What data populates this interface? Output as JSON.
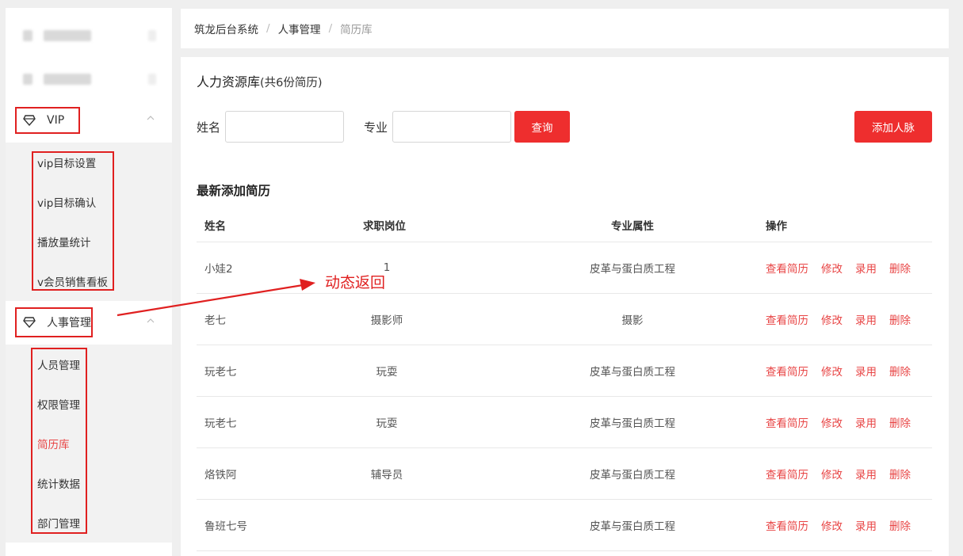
{
  "sidebar": {
    "vip_label": "VIP",
    "vip_items": [
      {
        "label": "vip目标设置"
      },
      {
        "label": "vip目标确认"
      },
      {
        "label": "播放量统计"
      },
      {
        "label": "v会员销售看板"
      }
    ],
    "hr_label": "人事管理",
    "hr_items": [
      {
        "label": "人员管理"
      },
      {
        "label": "权限管理"
      },
      {
        "label": "简历库",
        "active": true
      },
      {
        "label": "统计数据"
      },
      {
        "label": "部门管理"
      }
    ]
  },
  "breadcrumb": [
    "筑龙后台系统",
    "人事管理",
    "简历库"
  ],
  "card": {
    "title": "人力资源库",
    "title_suffix": "(共6份简历)"
  },
  "filters": {
    "name_label": "姓名",
    "major_label": "专业",
    "name_value": "",
    "major_value": "",
    "query_button": "查询",
    "add_button": "添加人脉"
  },
  "table": {
    "section_title": "最新添加简历",
    "headers": [
      "姓名",
      "求职岗位",
      "专业属性",
      "操作"
    ],
    "rows": [
      {
        "name": "小娃2",
        "position": "1",
        "major": "皮革与蛋白质工程"
      },
      {
        "name": "老七",
        "position": "摄影师",
        "major": "摄影"
      },
      {
        "name": "玩老七",
        "position": "玩耍",
        "major": "皮革与蛋白质工程"
      },
      {
        "name": "玩老七",
        "position": "玩耍",
        "major": "皮革与蛋白质工程"
      },
      {
        "name": "烙铁阿",
        "position": "辅导员",
        "major": "皮革与蛋白质工程"
      },
      {
        "name": "鲁班七号",
        "position": "",
        "major": "皮革与蛋白质工程"
      }
    ],
    "actions": [
      "查看简历",
      "修改",
      "录用",
      "删除"
    ]
  },
  "annotation": {
    "text": "动态返回",
    "color": "#e02020"
  },
  "colors": {
    "accent": "#ee2e2e",
    "link": "#e84545",
    "sidebar_bg": "#ffffff",
    "submenu_bg": "#f2f2f2"
  }
}
